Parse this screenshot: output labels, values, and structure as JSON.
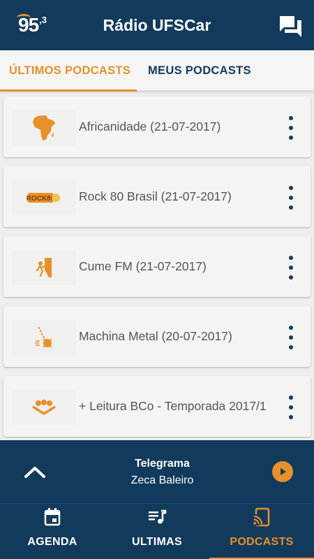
{
  "header": {
    "logo_number": "95",
    "logo_decimal": ",3",
    "title": "Rádio UFSCar",
    "chat_icon": "chat-bubbles-icon"
  },
  "tabs": [
    {
      "label": "ÚLTIMOS PODCASTS",
      "active": true
    },
    {
      "label": "MEUS PODCASTS",
      "active": false
    }
  ],
  "podcasts": [
    {
      "title": "Africanidade (21-07-2017)",
      "thumb_icon": "africa-map-icon",
      "thumb_text": ""
    },
    {
      "title": "Rock 80 Brasil (21-07-2017)",
      "thumb_icon": "rock80-logo-icon",
      "thumb_text": "ROCK80"
    },
    {
      "title": "Cume FM (21-07-2017)",
      "thumb_icon": "climber-icon",
      "thumb_text": ""
    },
    {
      "title": "Machina Metal (20-07-2017)",
      "thumb_icon": "wrecking-ball-icon",
      "thumb_text": ""
    },
    {
      "title": "+ Leitura BCo - Temporada 2017/1",
      "thumb_icon": "readers-group-icon",
      "thumb_text": ""
    }
  ],
  "player": {
    "title": "Telegrama",
    "artist": "Zeca Baleiro"
  },
  "bottom_nav": [
    {
      "label": "AGENDA",
      "icon": "calendar-icon",
      "active": false
    },
    {
      "label": "ULTIMAS",
      "icon": "playlist-icon",
      "active": false
    },
    {
      "label": "PODCASTS",
      "icon": "cast-icon",
      "active": true
    }
  ],
  "colors": {
    "primary": "#123a5c",
    "accent": "#e8902a",
    "card_bg": "#f4f4f2",
    "text": "#555555"
  }
}
